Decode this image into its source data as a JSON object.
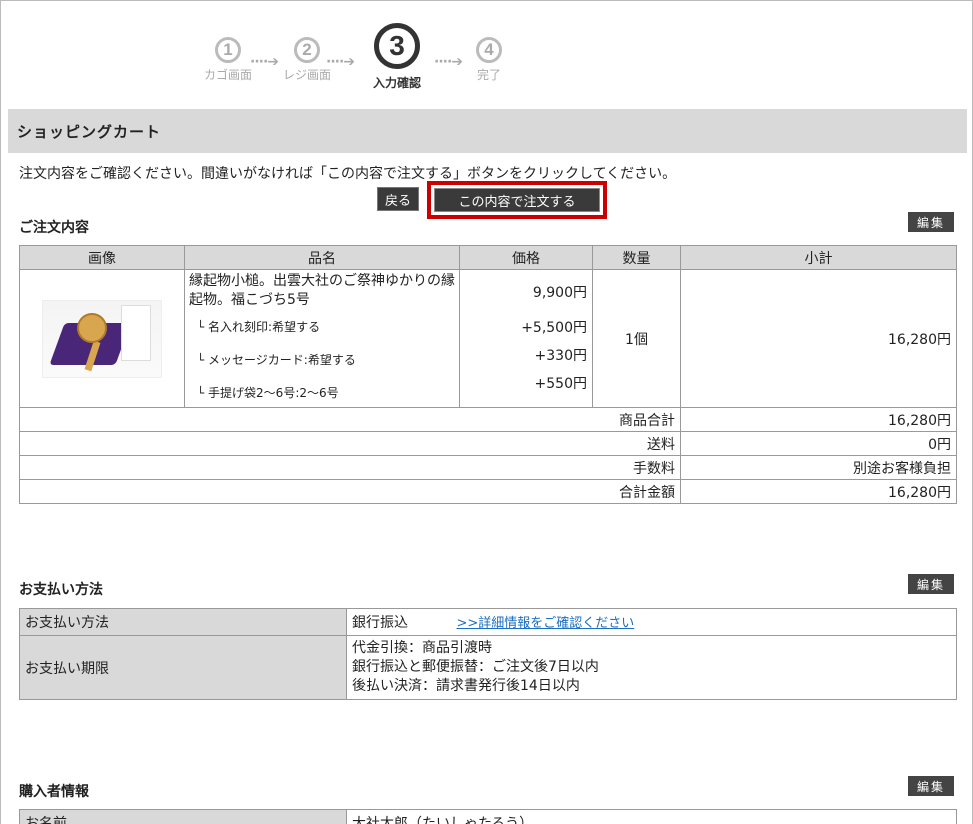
{
  "steps": [
    {
      "num": "1",
      "label": "カゴ画面"
    },
    {
      "num": "2",
      "label": "レジ画面"
    },
    {
      "num": "3",
      "label": "入力確認"
    },
    {
      "num": "4",
      "label": "完了"
    }
  ],
  "arrow": "····➔",
  "cart_title": "ショッピングカート",
  "instruction": "注文内容をご確認ください。間違いがなければ「この内容で注文する」ボタンをクリックしてください。",
  "buttons": {
    "back": "戻る",
    "order": "この内容で注文する",
    "edit": "編集"
  },
  "order": {
    "title": "ご注文内容",
    "headers": [
      "画像",
      "品名",
      "価格",
      "数量",
      "小計"
    ],
    "product_name": "縁起物小槌。出雲大社のご祭神ゆかりの縁起物。福こづち5号",
    "base_price": "9,900円",
    "options": [
      {
        "label": "名入れ刻印:希望する",
        "price": "+5,500円"
      },
      {
        "label": "メッセージカード:希望する",
        "price": "+330円"
      },
      {
        "label": "手提げ袋2〜6号:2〜6号",
        "price": "+550円"
      }
    ],
    "quantity": "1個",
    "subtotal": "16,280円",
    "summary": [
      {
        "label": "商品合計",
        "value": "16,280円"
      },
      {
        "label": "送料",
        "value": "0円"
      },
      {
        "label": "手数料",
        "value": "別途お客様負担"
      },
      {
        "label": "合計金額",
        "value": "16,280円"
      }
    ]
  },
  "payment": {
    "title": "お支払い方法",
    "method_label": "お支払い方法",
    "method_value": "銀行振込",
    "method_link": ">>詳細情報をご確認ください",
    "deadline_label": "お支払い期限",
    "deadline_lines": [
      "代金引換：商品引渡時",
      "銀行振込と郵便振替：ご注文後7日以内",
      "後払い決済：請求書発行後14日以内"
    ]
  },
  "purchaser": {
    "title": "購入者情報",
    "name_label": "お名前",
    "name_value": "大社太郎（たいしゃたろう）"
  }
}
